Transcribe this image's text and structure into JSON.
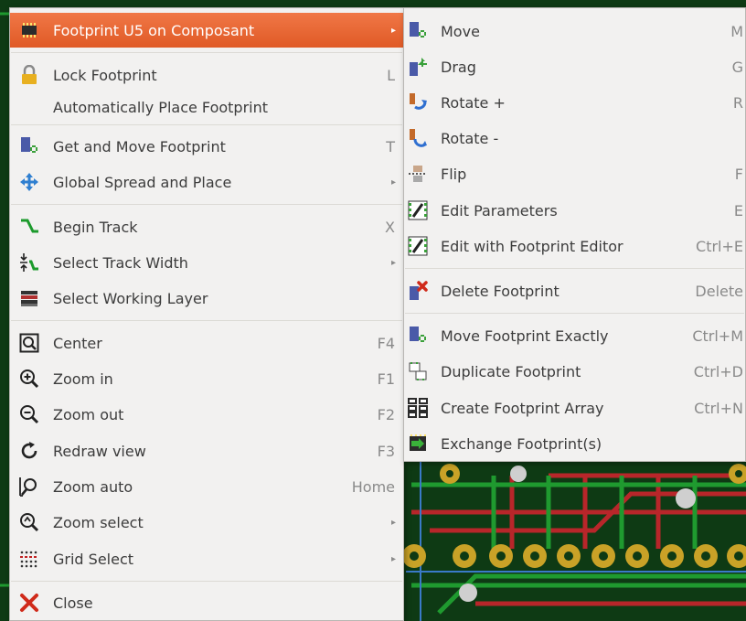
{
  "main_menu": {
    "header": {
      "label": "Footprint U5 on Composant",
      "icon": "footprint-chip-icon"
    },
    "lock_footprint": {
      "label": "Lock Footprint",
      "shortcut": "L",
      "icon": "lock-icon"
    },
    "auto_place": {
      "label": "Automatically Place Footprint"
    },
    "get_move": {
      "label": "Get and Move Footprint",
      "shortcut": "T",
      "icon": "move-footprint-icon"
    },
    "global_spread": {
      "label": "Global Spread and Place",
      "icon": "spread-arrows-icon"
    },
    "begin_track": {
      "label": "Begin Track",
      "shortcut": "X",
      "icon": "track-icon"
    },
    "select_track_width": {
      "label": "Select Track Width",
      "icon": "track-width-icon"
    },
    "select_working_layer": {
      "label": "Select Working Layer",
      "icon": "layers-icon"
    },
    "center": {
      "label": "Center",
      "shortcut": "F4",
      "icon": "center-icon"
    },
    "zoom_in": {
      "label": "Zoom in",
      "shortcut": "F1",
      "icon": "zoom-in-icon"
    },
    "zoom_out": {
      "label": "Zoom out",
      "shortcut": "F2",
      "icon": "zoom-out-icon"
    },
    "redraw_view": {
      "label": "Redraw view",
      "shortcut": "F3",
      "icon": "redraw-icon"
    },
    "zoom_auto": {
      "label": "Zoom auto",
      "shortcut": "Home",
      "icon": "zoom-auto-icon"
    },
    "zoom_select": {
      "label": "Zoom select",
      "icon": "zoom-select-icon"
    },
    "grid_select": {
      "label": "Grid Select",
      "icon": "grid-icon"
    },
    "close": {
      "label": "Close",
      "icon": "close-icon"
    }
  },
  "submenu": {
    "move": {
      "label": "Move",
      "shortcut": "M",
      "icon": "move-icon"
    },
    "drag": {
      "label": "Drag",
      "shortcut": "G",
      "icon": "drag-icon"
    },
    "rotate_plus": {
      "label": "Rotate +",
      "shortcut": "R",
      "icon": "rotate-cw-icon"
    },
    "rotate_minus": {
      "label": "Rotate -",
      "icon": "rotate-ccw-icon"
    },
    "flip": {
      "label": "Flip",
      "shortcut": "F",
      "icon": "flip-icon"
    },
    "edit_parameters": {
      "label": "Edit Parameters",
      "shortcut": "E",
      "icon": "edit-icon"
    },
    "edit_with_editor": {
      "label": "Edit with Footprint Editor",
      "shortcut": "Ctrl+E",
      "icon": "edit-editor-icon"
    },
    "delete_footprint": {
      "label": "Delete Footprint",
      "shortcut": "Delete",
      "icon": "delete-icon"
    },
    "move_exactly": {
      "label": "Move Footprint Exactly",
      "shortcut": "Ctrl+M",
      "icon": "move-exact-icon"
    },
    "duplicate": {
      "label": "Duplicate Footprint",
      "shortcut": "Ctrl+D",
      "icon": "duplicate-icon"
    },
    "create_array": {
      "label": "Create Footprint Array",
      "shortcut": "Ctrl+N",
      "icon": "array-icon"
    },
    "exchange": {
      "label": "Exchange Footprint(s)",
      "icon": "exchange-icon"
    }
  },
  "colors": {
    "highlight": "#e9672f",
    "menu_bg": "#f2f1f0",
    "pcb_bg": "#0e3a14",
    "track_green": "#1f8a2a",
    "track_red": "#c02a2a",
    "pad_gold": "#c9a227"
  }
}
